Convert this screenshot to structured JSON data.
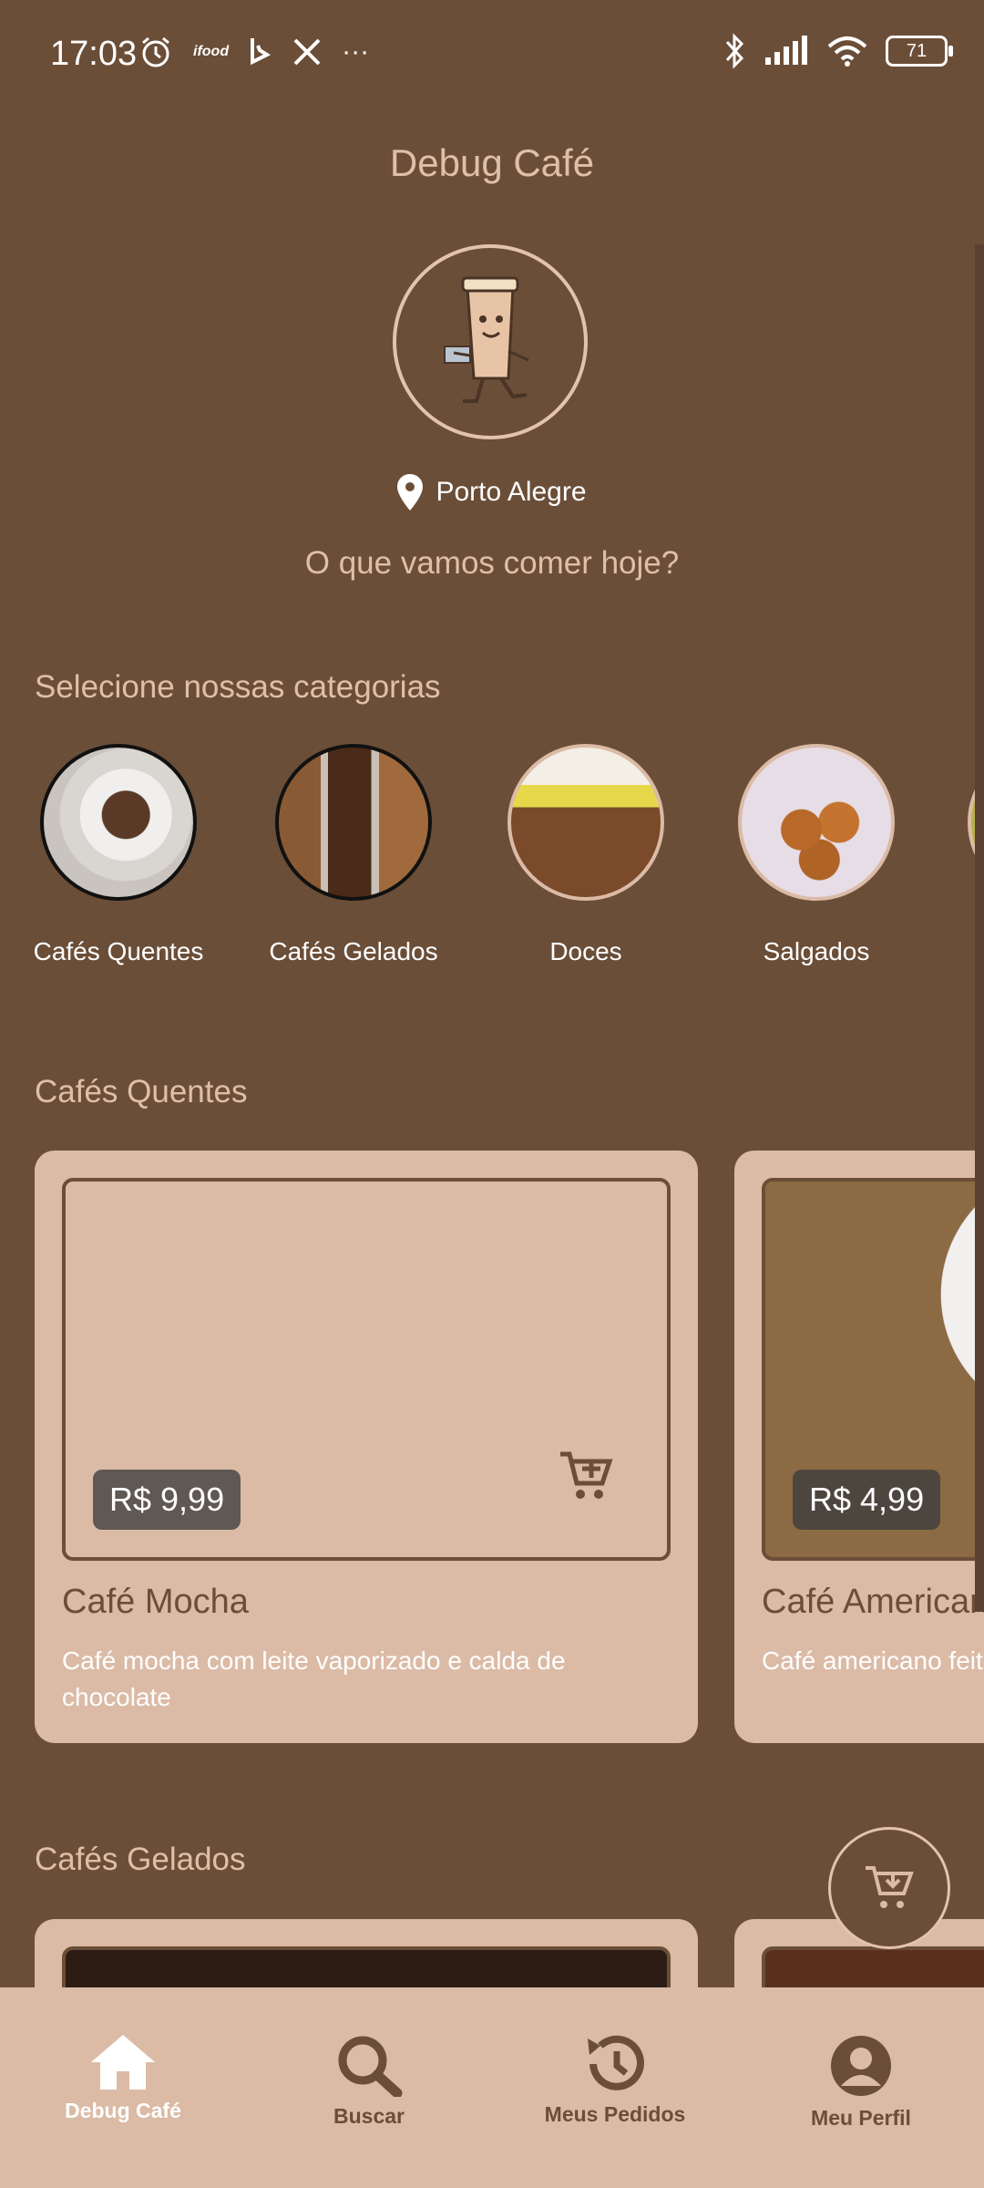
{
  "status_bar": {
    "time": "17:03",
    "ifood_label": "ifood",
    "more": "···",
    "battery": "71"
  },
  "header": {
    "title": "Debug Café",
    "location": "Porto Alegre",
    "question": "O que vamos comer hoje?"
  },
  "categories": {
    "title": "Selecione nossas categorias",
    "items": [
      {
        "label": "Cafés Quentes"
      },
      {
        "label": "Cafés Gelados"
      },
      {
        "label": "Doces"
      },
      {
        "label": "Salgados"
      }
    ]
  },
  "hot_coffees": {
    "title": "Cafés Quentes",
    "products": [
      {
        "name": "Café Mocha",
        "price": "R$ 9,99",
        "description": "Café mocha com leite vaporizado e calda de chocolate"
      },
      {
        "name": "Café Americano",
        "price": "R$ 4,99",
        "description": "Café americano feito"
      }
    ]
  },
  "iced_coffees": {
    "title": "Cafés Gelados"
  },
  "bottom_nav": {
    "items": [
      {
        "label": "Debug Café",
        "icon": "home-icon",
        "active": true
      },
      {
        "label": "Buscar",
        "icon": "search-icon"
      },
      {
        "label": "Meus Pedidos",
        "icon": "history-icon"
      },
      {
        "label": "Meu Perfil",
        "icon": "profile-icon"
      }
    ]
  },
  "colors": {
    "background": "#6b4e38",
    "accent": "#dbbba6",
    "title": "#e0bfa6"
  }
}
